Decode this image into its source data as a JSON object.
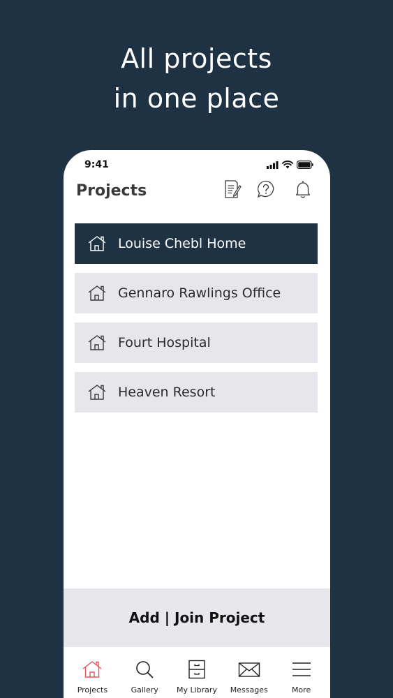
{
  "headline": {
    "line1": "All projects",
    "line2": "in one place"
  },
  "status_bar": {
    "time": "9:41",
    "icons": [
      "cellular-signal-icon",
      "wifi-icon",
      "battery-icon"
    ]
  },
  "header": {
    "title": "Projects",
    "icons": [
      "document-edit-icon",
      "help-icon",
      "bell-icon"
    ]
  },
  "projects": [
    {
      "name": "Louise Chebl Home",
      "selected": true
    },
    {
      "name": "Gennaro Rawlings Office",
      "selected": false
    },
    {
      "name": "Fourt Hospital",
      "selected": false
    },
    {
      "name": "Heaven Resort",
      "selected": false
    }
  ],
  "add_join_label": "Add | Join Project",
  "bottom_nav": [
    {
      "label": "Projects",
      "icon": "house-icon",
      "active": true
    },
    {
      "label": "Gallery",
      "icon": "search-icon",
      "active": false
    },
    {
      "label": "My Library",
      "icon": "cabinet-icon",
      "active": false
    },
    {
      "label": "Messages",
      "icon": "envelope-icon",
      "active": false
    },
    {
      "label": "More",
      "icon": "menu-icon",
      "active": false
    }
  ],
  "colors": {
    "background": "#1e3244",
    "selected_item": "#1e3244",
    "item_background": "#e7e6ea",
    "active_nav_icon": "#e25555"
  }
}
